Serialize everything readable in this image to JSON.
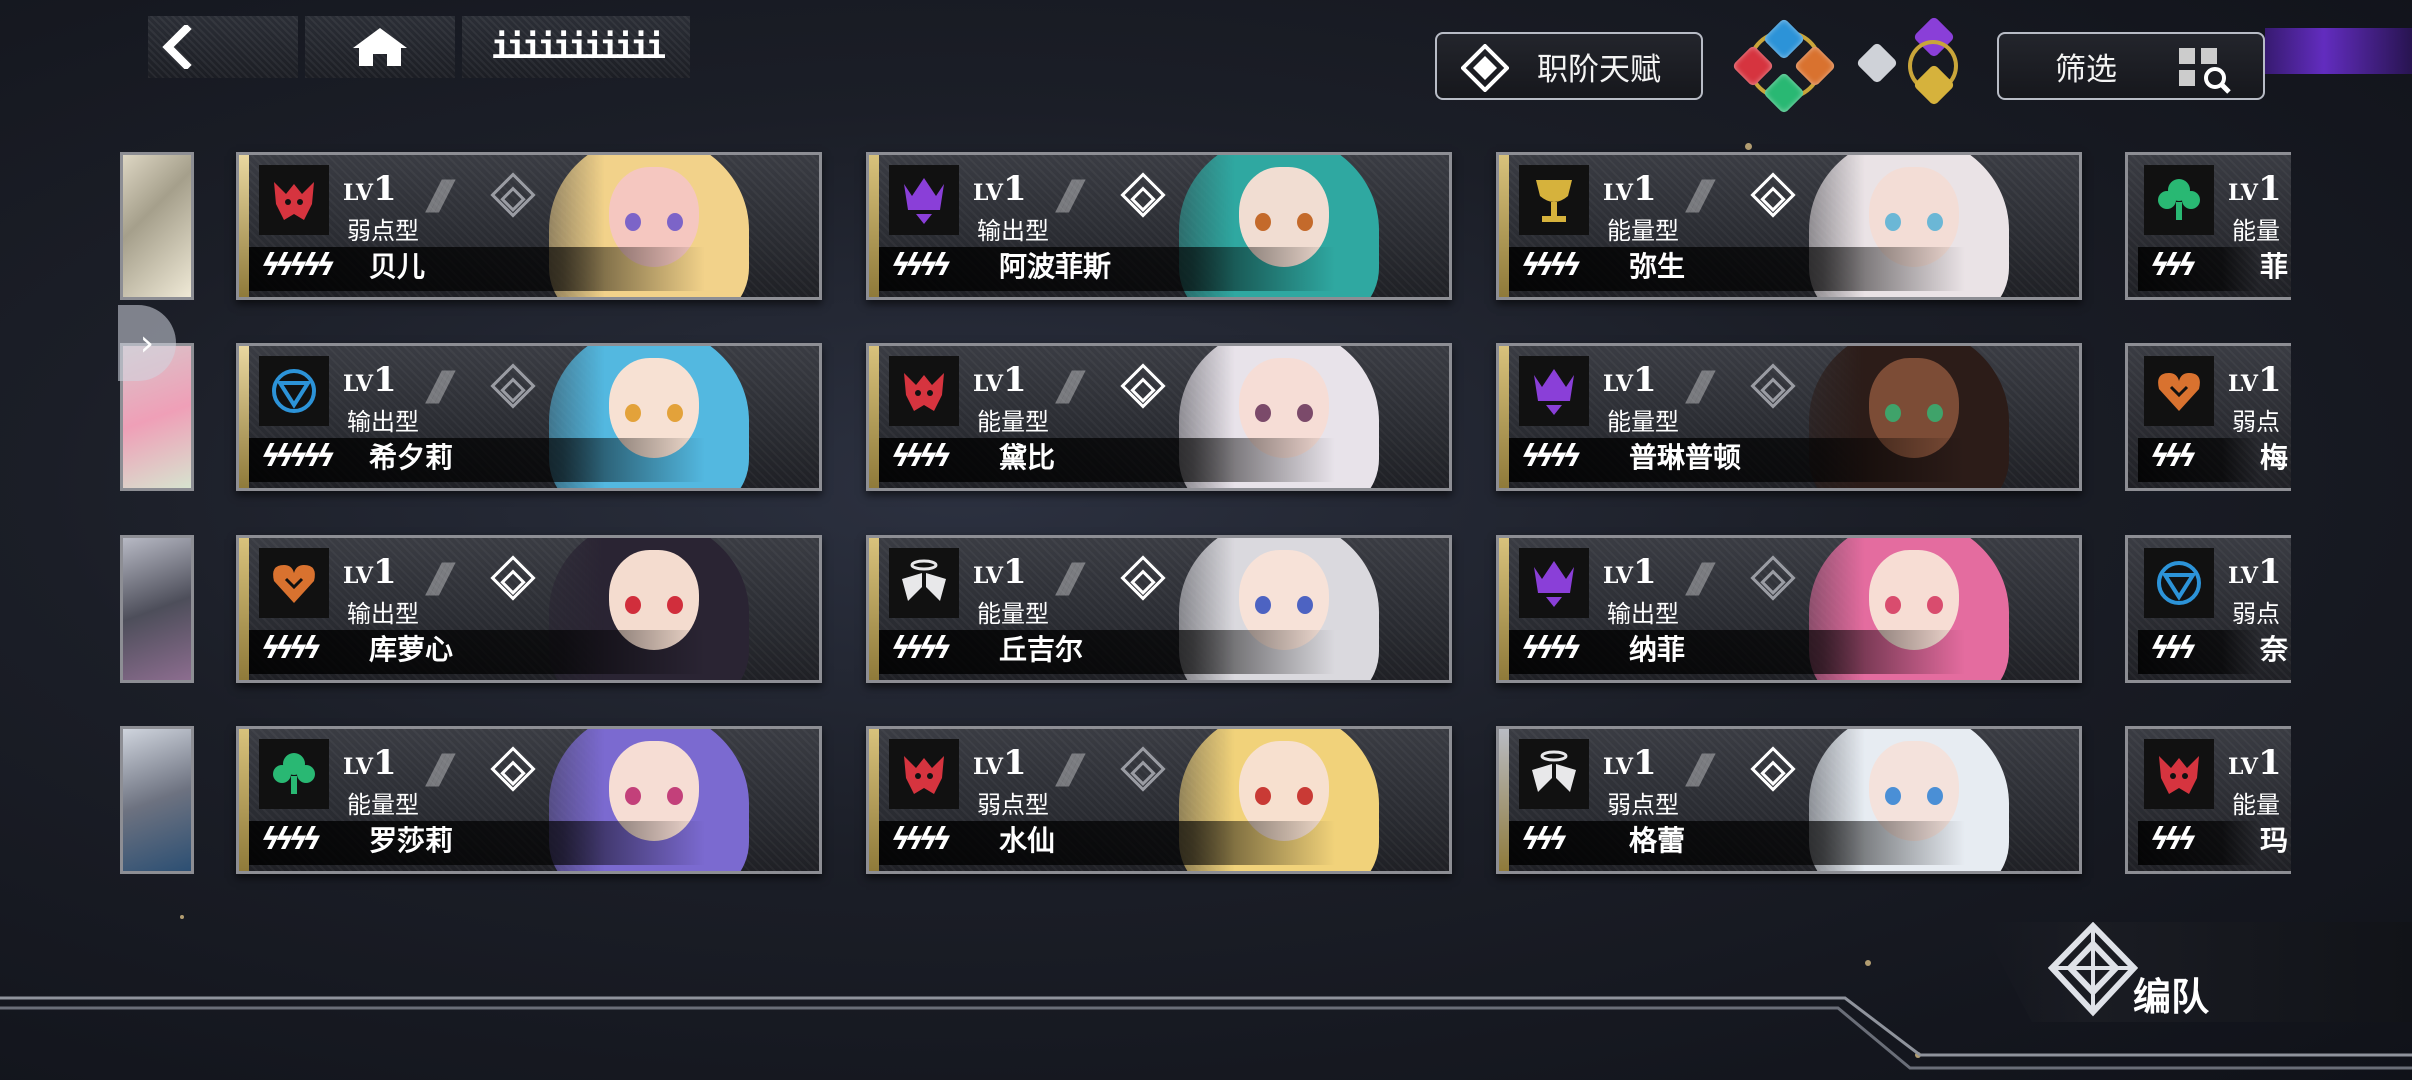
{
  "header": {
    "extra_label": "iiiiiiiiiii",
    "talent_label": "职阶天赋",
    "filter_label": "筛选"
  },
  "colors": {
    "red": "#d6343f",
    "purple": "#8a3fd8",
    "blue": "#2c93d8",
    "green": "#29b873",
    "orange": "#d9722f",
    "gold": "#d6b23c",
    "white": "#e8e8ea"
  },
  "cards": [
    {
      "id": "c1",
      "name": "贝儿",
      "lv_prefix": "LV",
      "lv": "1",
      "type": "弱点型",
      "stars": "44444",
      "rarity_label": "",
      "icon": "wolf-icon",
      "color": "red",
      "diamond_on": false,
      "bar": "#e9d7a0"
    },
    {
      "id": "c2",
      "name": "阿波菲斯",
      "lv_prefix": "LV",
      "lv": "1",
      "type": "输出型",
      "stars": "4444",
      "icon": "crown-icon",
      "color": "purple",
      "diamond_on": true,
      "bar": "#d8c27c"
    },
    {
      "id": "c3",
      "name": "弥生",
      "lv_prefix": "LV",
      "lv": "1",
      "type": "能量型",
      "stars": "4444",
      "icon": "chalice-icon",
      "color": "gold",
      "diamond_on": true,
      "bar": "#d8c27c"
    },
    {
      "id": "c4",
      "name": "希夕莉",
      "lv_prefix": "LV",
      "lv": "1",
      "type": "输出型",
      "stars": "44444",
      "icon": "orb-icon",
      "color": "blue",
      "diamond_on": false,
      "bar": "#e9d7a0"
    },
    {
      "id": "c5",
      "name": "黛比",
      "lv_prefix": "LV",
      "lv": "1",
      "type": "能量型",
      "stars": "4444",
      "icon": "wolf-icon",
      "color": "red",
      "diamond_on": true,
      "bar": "#d8c27c"
    },
    {
      "id": "c6",
      "name": "普琳普顿",
      "lv_prefix": "LV",
      "lv": "1",
      "type": "能量型",
      "stars": "4444",
      "icon": "crown-icon",
      "color": "purple",
      "diamond_on": false,
      "bar": "#d8c27c"
    },
    {
      "id": "c7",
      "name": "库萝心",
      "lv_prefix": "LV",
      "lv": "1",
      "type": "输出型",
      "stars": "4444",
      "icon": "heart-icon",
      "color": "orange",
      "diamond_on": true,
      "bar": "#d8c27c"
    },
    {
      "id": "c8",
      "name": "丘吉尔",
      "lv_prefix": "LV",
      "lv": "1",
      "type": "能量型",
      "stars": "4444",
      "icon": "wings-icon",
      "color": "white",
      "diamond_on": true,
      "bar": "#d8c27c"
    },
    {
      "id": "c9",
      "name": "纳菲",
      "lv_prefix": "LV",
      "lv": "1",
      "type": "输出型",
      "stars": "4444",
      "icon": "crown-icon",
      "color": "purple",
      "diamond_on": false,
      "bar": "#d8c27c"
    },
    {
      "id": "c10",
      "name": "罗莎莉",
      "lv_prefix": "LV",
      "lv": "1",
      "type": "能量型",
      "stars": "4444",
      "icon": "tree-icon",
      "color": "green",
      "diamond_on": true,
      "bar": "#d8c27c"
    },
    {
      "id": "c11",
      "name": "水仙",
      "lv_prefix": "LV",
      "lv": "1",
      "type": "弱点型",
      "stars": "4444",
      "icon": "wolf-icon",
      "color": "red",
      "diamond_on": false,
      "bar": "#d8c27c"
    },
    {
      "id": "c12",
      "name": "格蕾",
      "lv_prefix": "LV",
      "lv": "1",
      "type": "弱点型",
      "stars": "444",
      "icon": "wings-icon",
      "color": "white",
      "diamond_on": true,
      "bar": "#b9bcc4"
    }
  ],
  "edge_cards": [
    {
      "name": "菲",
      "lv": "1",
      "type": "能量",
      "stars": "444",
      "icon": "tree-icon",
      "color": "green"
    },
    {
      "name": "梅",
      "lv": "1",
      "type": "弱点",
      "stars": "444",
      "icon": "heart-icon",
      "color": "orange"
    },
    {
      "name": "奈",
      "lv": "1",
      "type": "弱点",
      "stars": "444",
      "icon": "orb-icon",
      "color": "blue"
    },
    {
      "name": "玛",
      "lv": "1",
      "type": "能量",
      "stars": "444",
      "icon": "wolf-icon",
      "color": "red"
    }
  ],
  "team_button": {
    "label": "编队"
  }
}
